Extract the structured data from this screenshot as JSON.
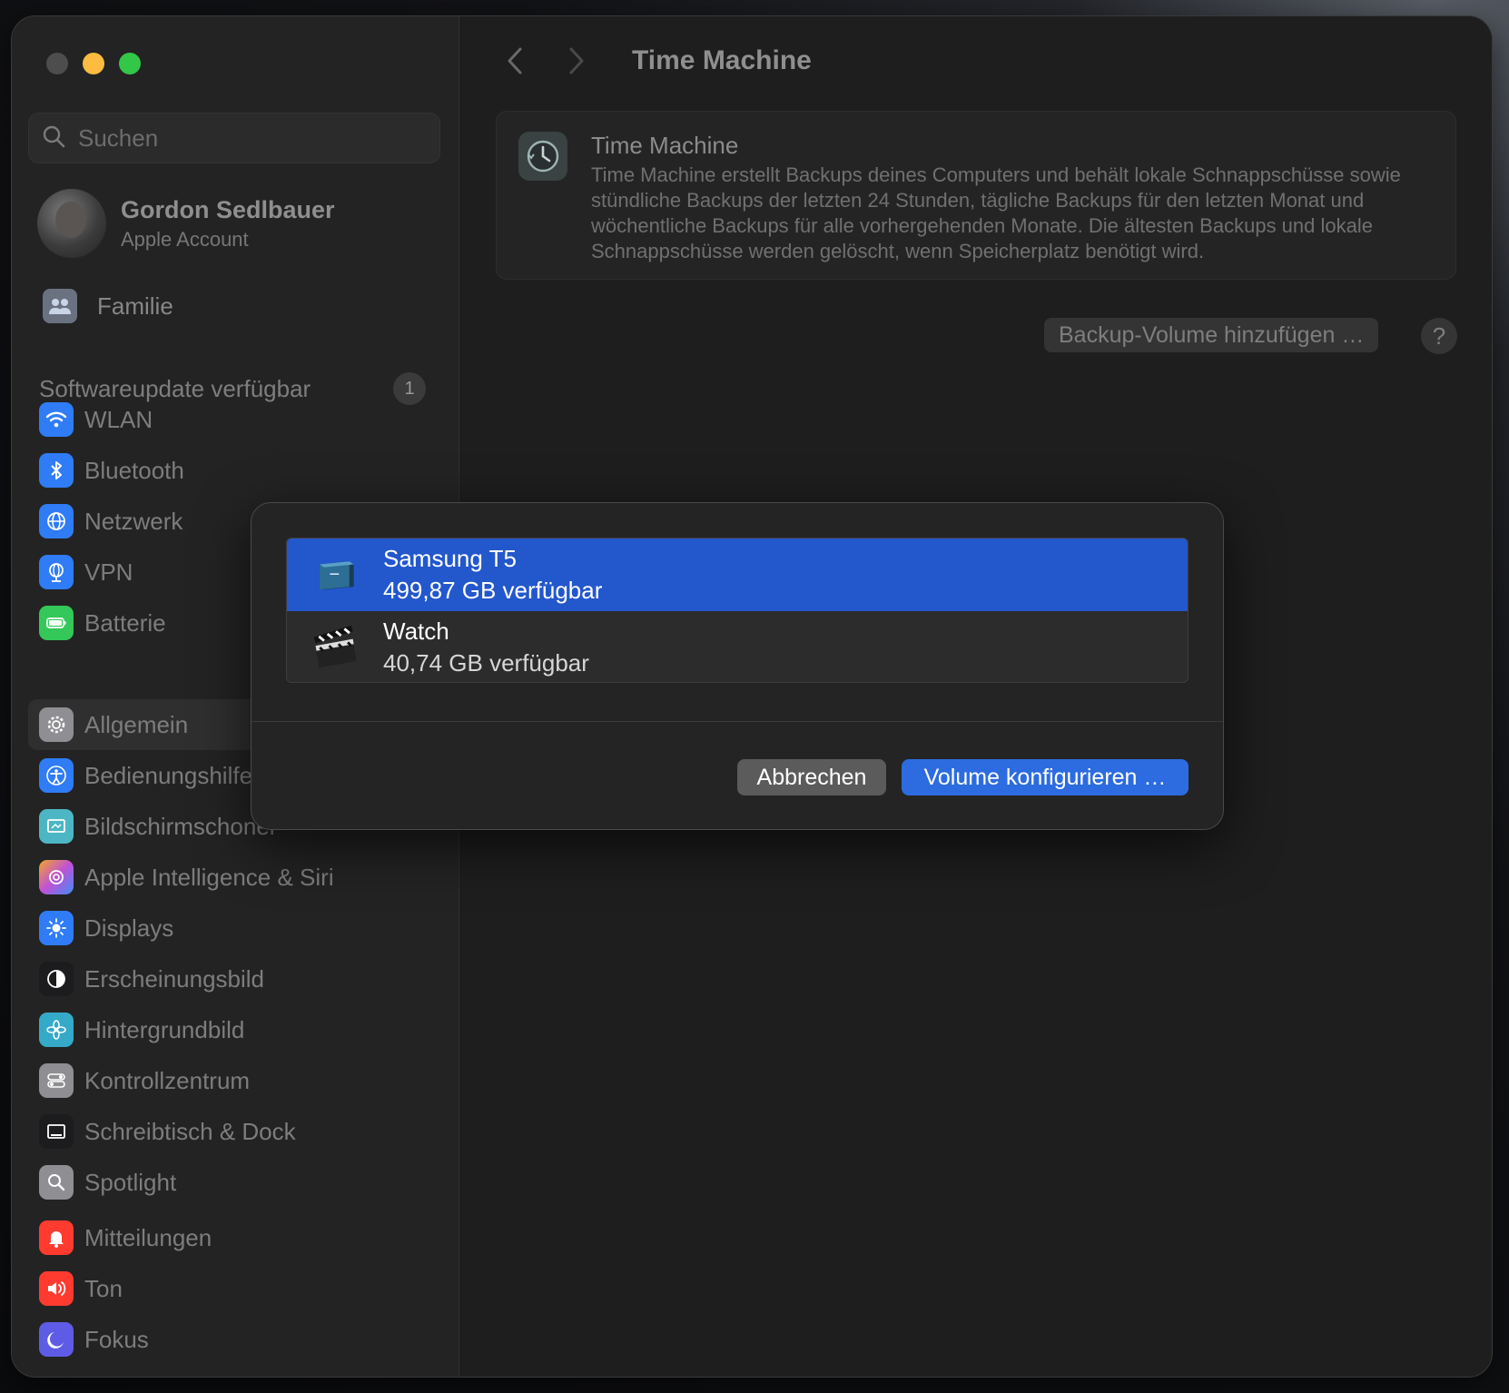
{
  "window": {
    "traffic_lights": [
      "close",
      "minimize",
      "zoom"
    ]
  },
  "sidebar": {
    "search": {
      "placeholder": "Suchen",
      "value": ""
    },
    "account": {
      "name": "Gordon Sedlbauer",
      "subtitle": "Apple Account"
    },
    "family": {
      "label": "Familie"
    },
    "update": {
      "label": "Softwareupdate verfügbar",
      "badge": "1"
    },
    "groups": [
      [
        {
          "label": "WLAN",
          "icon": "wifi-icon",
          "color": "#2f7cf6"
        },
        {
          "label": "Bluetooth",
          "icon": "bluetooth-icon",
          "color": "#2f7cf6"
        },
        {
          "label": "Netzwerk",
          "icon": "globe-icon",
          "color": "#2f7cf6"
        },
        {
          "label": "VPN",
          "icon": "vpn-globe-icon",
          "color": "#2f7cf6"
        },
        {
          "label": "Batterie",
          "icon": "battery-icon",
          "color": "#34c759"
        }
      ],
      [
        {
          "label": "Allgemein",
          "icon": "gear-icon",
          "color": "#8e8e93",
          "active": true
        },
        {
          "label": "Bedienungshilfen",
          "icon": "accessibility-icon",
          "color": "#2f7cf6"
        },
        {
          "label": "Bildschirmschoner",
          "icon": "screensaver-icon",
          "color": "#4db6c4"
        },
        {
          "label": "Apple Intelligence & Siri",
          "icon": "siri-icon",
          "color": "#c052d6"
        },
        {
          "label": "Displays",
          "icon": "sun-icon",
          "color": "#2f7cf6"
        },
        {
          "label": "Erscheinungsbild",
          "icon": "appearance-icon",
          "color": "#1c1c1e"
        },
        {
          "label": "Hintergrundbild",
          "icon": "flower-icon",
          "color": "#35aac8"
        },
        {
          "label": "Kontrollzentrum",
          "icon": "toggles-icon",
          "color": "#8e8e93"
        },
        {
          "label": "Schreibtisch & Dock",
          "icon": "dock-icon",
          "color": "#1c1c1e"
        },
        {
          "label": "Spotlight",
          "icon": "magnifier-icon",
          "color": "#8e8e93"
        }
      ],
      [
        {
          "label": "Mitteilungen",
          "icon": "bell-icon",
          "color": "#ff3b30"
        },
        {
          "label": "Ton",
          "icon": "speaker-icon",
          "color": "#ff3b30"
        },
        {
          "label": "Fokus",
          "icon": "moon-icon",
          "color": "#5e5ce6"
        }
      ]
    ]
  },
  "main": {
    "page_title": "Time Machine",
    "info": {
      "title": "Time Machine",
      "description": "Time Machine erstellt Backups deines Computers und behält lokale Schnappschüsse sowie stündliche Backups der letzten 24 Stunden, tägliche Backups für den letzten Monat und wöchentliche Backups für alle vorhergehenden Monate. Die ältesten Backups und lokale Schnappschüsse werden gelöscht, wenn Speicherplatz benötigt wird."
    },
    "add_button": "Backup-Volume hinzufügen …",
    "help_button": "?"
  },
  "dialog": {
    "volumes": [
      {
        "name": "Samsung T5",
        "size": "499,87 GB verfügbar",
        "icon": "external-drive-icon",
        "selected": true
      },
      {
        "name": "Watch",
        "size": "40,74 GB verfügbar",
        "icon": "clapperboard-icon",
        "selected": false
      }
    ],
    "cancel_label": "Abbrechen",
    "confirm_label": "Volume konfigurieren …"
  },
  "colors": {
    "accent": "#2c6ce0",
    "selection": "#2357cc",
    "close_light": "#4d4d4d",
    "minimize_light": "#fdbc40",
    "zoom_light": "#33c748"
  }
}
